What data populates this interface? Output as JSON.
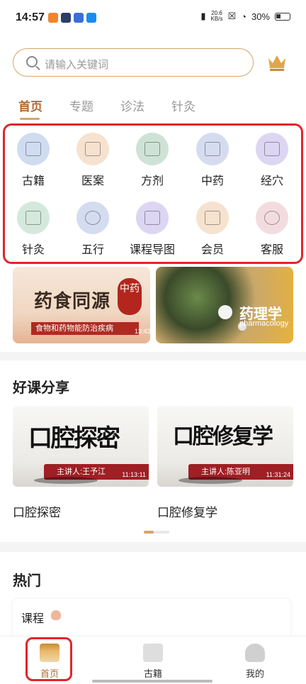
{
  "status_bar": {
    "time": "14:57",
    "net_speed_top": "20.6",
    "net_speed_unit": "KB/s",
    "battery": "30%"
  },
  "search": {
    "placeholder": "请输入关键词"
  },
  "tabs": [
    {
      "label": "首页",
      "active": true
    },
    {
      "label": "专题"
    },
    {
      "label": "诊法"
    },
    {
      "label": "针灸"
    }
  ],
  "categories": [
    {
      "label": "古籍",
      "icon": "book-icon",
      "color": "#cfdcf0"
    },
    {
      "label": "医案",
      "icon": "scroll-icon",
      "color": "#f6e2cf"
    },
    {
      "label": "方剂",
      "icon": "prescription-icon",
      "color": "#cfe2d6"
    },
    {
      "label": "中药",
      "icon": "herb-card-icon",
      "color": "#d6dcf0"
    },
    {
      "label": "经穴",
      "icon": "acupoint-figure-icon",
      "color": "#dcd6f3"
    },
    {
      "label": "针灸",
      "icon": "bamboo-icon",
      "color": "#d4e9dc"
    },
    {
      "label": "五行",
      "icon": "five-elements-icon",
      "color": "#d4dcf0"
    },
    {
      "label": "课程导图",
      "icon": "mind-map-icon",
      "color": "#dcd6f3"
    },
    {
      "label": "会员",
      "icon": "vip-crown-icon",
      "color": "#f6e2cf"
    },
    {
      "label": "客服",
      "icon": "service-avatar-icon",
      "color": "#f3dce0"
    }
  ],
  "banners": {
    "left": {
      "title": "药食同源",
      "seal": "中药",
      "caption": "食物和药物能防治疾病",
      "duration": "13:43"
    },
    "right": {
      "title": "药理学",
      "subtitle": "pharmacology"
    }
  },
  "share": {
    "title": "好课分享",
    "courses": [
      {
        "thumb_text": "口腔探密",
        "lecturer": "主讲人:王予江",
        "duration": "11:13:11",
        "name": "口腔探密"
      },
      {
        "thumb_text": "口腔修复学",
        "lecturer": "主讲人:陈亚明",
        "duration": "11:31:24",
        "name": "口腔修复学"
      }
    ]
  },
  "hot": {
    "title": "热门",
    "card_label": "课程"
  },
  "nav": [
    {
      "label": "首页",
      "icon": "home-temple-icon",
      "active": true
    },
    {
      "label": "古籍",
      "icon": "ancient-book-icon"
    },
    {
      "label": "我的",
      "icon": "profile-icon"
    }
  ],
  "colors": {
    "accent": "#b06a34",
    "highlight": "#e0262a",
    "search_border": "#d7a46a"
  }
}
